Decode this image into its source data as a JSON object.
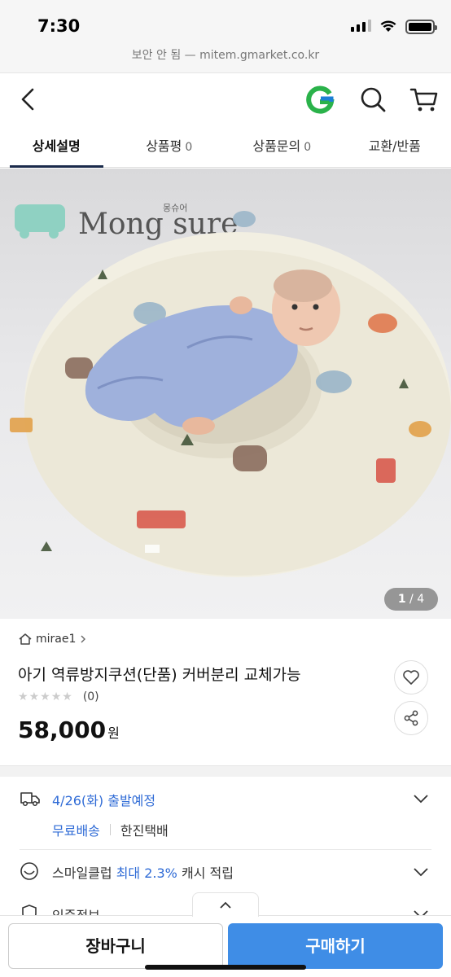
{
  "status": {
    "time": "7:30"
  },
  "browser": {
    "url_text": "보안 안 됨 — mitem.gmarket.co.kr"
  },
  "header": {
    "icons": [
      "back-icon",
      "gmarket-g-logo",
      "search-icon",
      "cart-icon"
    ],
    "brand_color": "#2ab24a"
  },
  "tabs": [
    {
      "label": "상세설명",
      "count": ""
    },
    {
      "label": "상품평",
      "count": "0"
    },
    {
      "label": "상품문의",
      "count": "0"
    },
    {
      "label": "교환/반품",
      "count": ""
    }
  ],
  "gallery": {
    "brand_text": "Mong sure",
    "brand_korean": "몽슈어",
    "current": "1",
    "total": "4"
  },
  "product": {
    "seller": "mirae1",
    "title": "아기 역류방지쿠션(단품) 커버분리 교체가능",
    "rating_stars": 0,
    "review_count": "(0)",
    "price": "58,000",
    "currency": "원"
  },
  "shipping": {
    "date": "4/26(화)",
    "status": "출발예정",
    "free_label": "무료배송",
    "carrier": "한진택배"
  },
  "smileclub": {
    "prefix": "스마일클럽",
    "max_label": "최대 2.3%",
    "suffix": "캐시 적립"
  },
  "certification": {
    "label": "인증정보"
  },
  "actions": {
    "cart": "장바구니",
    "buy": "구매하기"
  },
  "colors": {
    "accent_blue": "#2f6bd6",
    "buy_button": "#3f8de6",
    "tab_underline": "#1a2a4a"
  }
}
